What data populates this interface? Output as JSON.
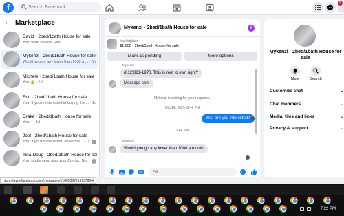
{
  "topbar": {
    "logo": "f",
    "search_placeholder": "Search Facebook",
    "notifications_badge": "9",
    "nav_icons": [
      "home-icon",
      "friends-icon",
      "marketplace-icon",
      "groups-icon"
    ],
    "right_icons": [
      "menu-grid-icon",
      "messenger-icon",
      "bell-icon",
      "avatar"
    ]
  },
  "sidebar": {
    "title": "Marketplace",
    "conversations": [
      {
        "name": "David · 2bed/1bath House for sale",
        "preview": "You: what means · 4m"
      },
      {
        "name": "Mykenzi · 2bed/1bath House for sale",
        "preview": "Would you go any lower than 1000 a ... · 6h"
      },
      {
        "name": "Michele · 2bed/1bath House for sale",
        "preview": "You 👍 · 1d"
      },
      {
        "name": "Eric · 2bed/1bath House for sale",
        "preview": "You: If you're interested in buying the ... · 1d"
      },
      {
        "name": "Drake · 2bed/1bath House for sale",
        "preview": "You: I · 1d"
      },
      {
        "name": "Joel · 2bed/1bath House for sale",
        "preview": "You: If you're interested, do let me ... · 1d"
      },
      {
        "name": "Tina-Doug · 2bed/1bath House for sale",
        "preview": "You: kindly send also your Contact Nu... · 1d"
      }
    ]
  },
  "chat": {
    "title": "Mykenzi · 2bed/1bath House for sale",
    "listing_label": "Marketplace",
    "listing_detail": "$1,000 · 2bed/1bath House for sale",
    "mark_pending": "Mark as pending",
    "more_options": "More options",
    "sender_label_1": "Mykenzi",
    "msg_1": "(812)881-1970, This is rent to own right?",
    "msg_2": "Message sent",
    "waiting": "Mykenzi is waiting for your response.",
    "date_1": "Oct 14, 2025, 8:47 PM",
    "msg_out": "Yes, are you interested?",
    "time_2": "2:44 PM",
    "sender_label_2": "Mykenzi",
    "msg_3": "Would you go any lower than 1000 a month",
    "composer_placeholder": "Aa"
  },
  "right_panel": {
    "name": "Mykenzi · 2bed/1bath House for sale",
    "mute": "Mute",
    "search": "Search",
    "rows": [
      "Customize chat",
      "Chat members",
      "Media, files and links",
      "Privacy & support"
    ]
  },
  "status_url": "https://www.facebook.com/messages/t/1805387216737964/",
  "taskbar": {
    "time": "7:22 PM"
  },
  "colors": {
    "brand": "#1877f2",
    "outgoing_bubble": "#0a7cff",
    "accent_purple": "#a033ff"
  }
}
